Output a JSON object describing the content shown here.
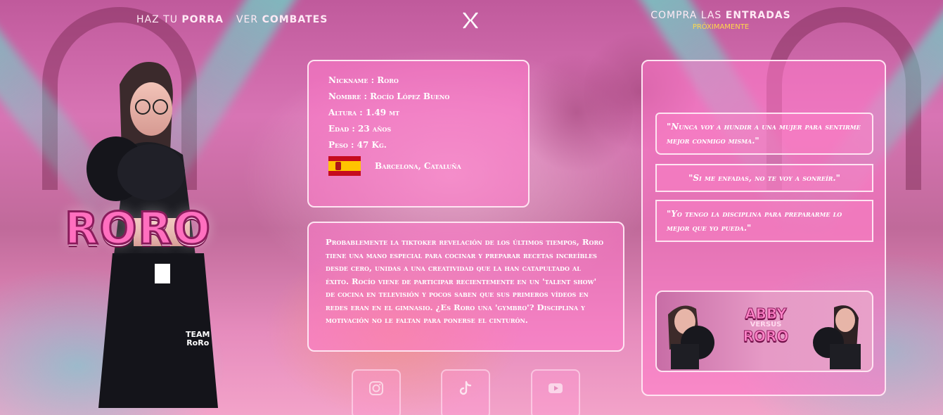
{
  "nav": {
    "porra_light": "HAZ TU ",
    "porra_bold": "PORRA",
    "combates_light": "VER ",
    "combates_bold": "COMBATES",
    "entradas_light": "COMPRA LAS ",
    "entradas_bold": "ENTRADAS",
    "entradas_sub": "PRÓXIMAMENTE",
    "logo_icon": "x-logo-icon"
  },
  "fighter": {
    "name": "RORO",
    "team_line1": "TEAM",
    "team_line2": "RoRo"
  },
  "info": {
    "nickname": "Nickname : Roro",
    "nombre": "Nombre : Rocío López Bueno",
    "altura": "Altura : 1.49 mt",
    "edad": "Edad : 23 años",
    "peso": "Peso : 47 Kg.",
    "flag_icon": "spain-flag-icon",
    "ciudad": "Barcelona, Cataluña"
  },
  "bio": "Probablemente la tiktoker revelación de los últimos tiempos, Roro tiene una mano especial para cocinar y preparar recetas increíbles desde cero, unidas a una creatividad que la han catapultado al éxito. Rocío viene de participar recientemente en un 'talent show' de cocina en televisión y pocos saben que sus primeros vídeos en redes eran en el gimnasio. ¿Es Roro una 'gymbro'? Disciplina y motivación no le faltan para ponerse el cinturón.",
  "quotes": [
    "\"Nunca voy a hundir a una mujer para sentirme mejor conmigo misma.\"",
    "\"Si me enfadas, no te voy a sonreír.\"",
    "\"Yo tengo la disciplina para prepararme lo mejor que yo pueda.\""
  ],
  "promo": {
    "line1": "ABBY",
    "versus": "VERSUS",
    "line2": "RORO"
  },
  "social": {
    "instagram_icon": "instagram-icon",
    "tiktok_icon": "tiktok-icon",
    "youtube_icon": "youtube-icon"
  },
  "colors": {
    "accent_pink": "#ff6fbf",
    "card_border": "#ffe4f2",
    "sub_yellow": "#ffd84a"
  }
}
